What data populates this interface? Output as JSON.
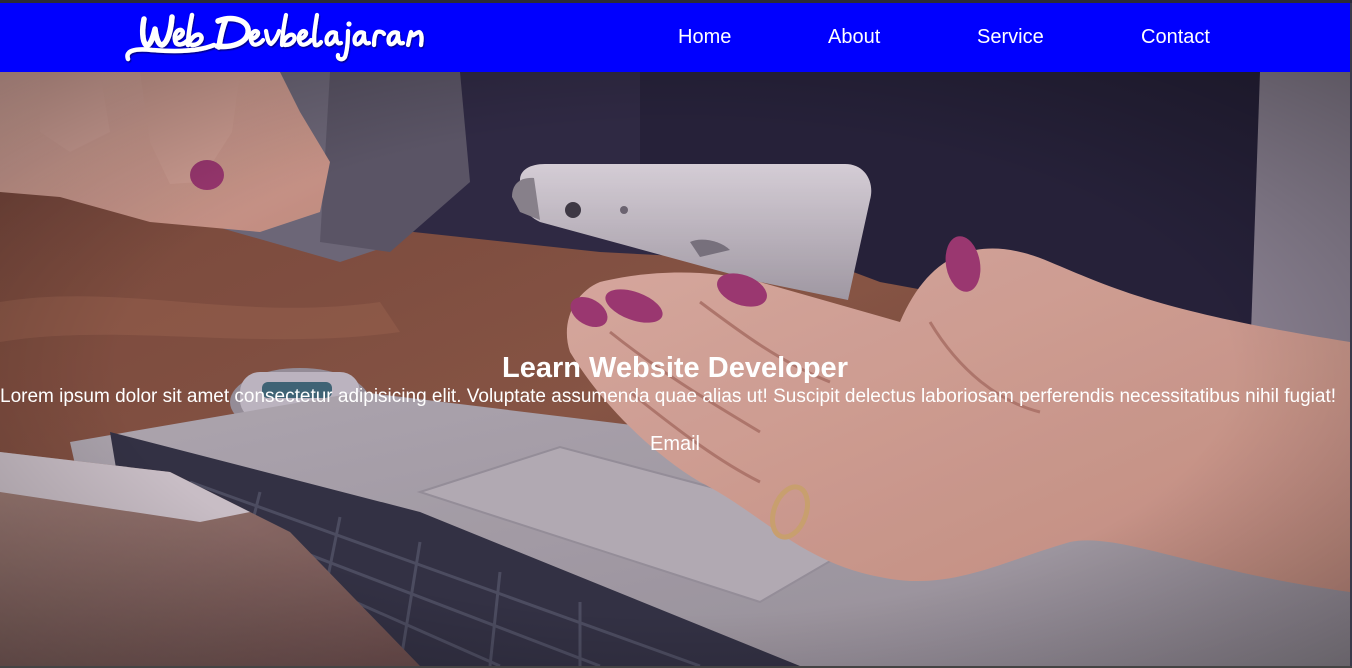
{
  "brand": {
    "logo_text": "Web Devbelajaran",
    "nav_color": "#0000ff"
  },
  "nav": {
    "items": [
      {
        "label": "Home"
      },
      {
        "label": "About"
      },
      {
        "label": "Service"
      },
      {
        "label": "Contact"
      }
    ]
  },
  "hero": {
    "image": "laptop-and-smartphone-photo",
    "title": "Learn Website Developer",
    "text": "Lorem ipsum dolor sit amet consectetur adipisicing elit. Voluptate assumenda quae alias ut! Suscipit delectus laboriosam perferendis necessitatibus nihil fugiat!",
    "email_label": "Email"
  }
}
